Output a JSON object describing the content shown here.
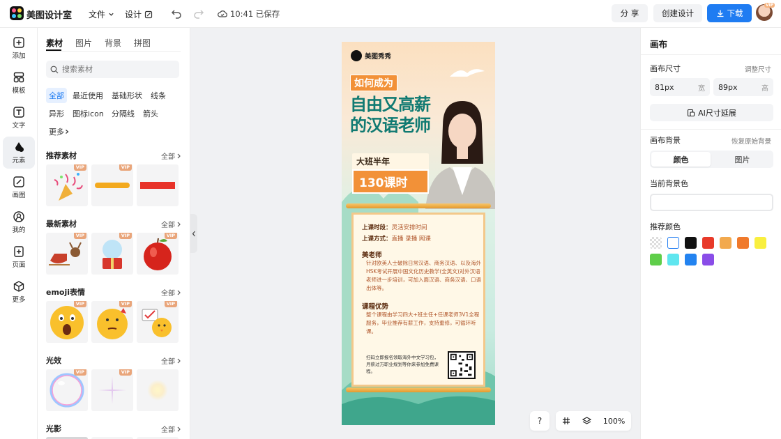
{
  "app": {
    "name": "美图设计室"
  },
  "toolbar": {
    "file_label": "文件",
    "design_label": "设计",
    "saved_status": "10:41 已保存",
    "share_label": "分 享",
    "create_label": "创建设计",
    "download_label": "下载",
    "avatar_badge": "VIP"
  },
  "leftnav": {
    "items": [
      {
        "label": "添加",
        "icon": "plus-square-icon"
      },
      {
        "label": "模板",
        "icon": "template-grid-icon"
      },
      {
        "label": "文字",
        "icon": "text-icon"
      },
      {
        "label": "元素",
        "icon": "shapes-icon",
        "active": true
      },
      {
        "label": "画图",
        "icon": "draw-icon"
      },
      {
        "label": "我的",
        "icon": "user-icon"
      },
      {
        "label": "页面",
        "icon": "page-add-icon"
      },
      {
        "label": "更多",
        "icon": "cube-icon"
      }
    ]
  },
  "panel": {
    "tabs": [
      "素材",
      "图片",
      "背景",
      "拼图"
    ],
    "active_tab": "素材",
    "search_placeholder": "搜索素材",
    "chips": [
      "全部",
      "最近使用",
      "基础形状",
      "线条",
      "异形",
      "图标icon",
      "分隔线",
      "箭头",
      "更多"
    ],
    "sections": [
      {
        "title": "推荐素材",
        "more": "全部"
      },
      {
        "title": "最新素材",
        "more": "全部"
      },
      {
        "title": "emoji表情",
        "more": "全部"
      },
      {
        "title": "光效",
        "more": "全部"
      },
      {
        "title": "光影",
        "more": "全部"
      }
    ],
    "vip_label": "VIP"
  },
  "poster": {
    "brand": "美图秀秀",
    "tag": "如何成为",
    "headline_line1": "自由又高薪",
    "headline_line2": "的汉语老师",
    "badge_line1": "大班半年",
    "badge_line2": "130课时",
    "schedule_label": "上课时段：",
    "schedule_value": "灵活安排时间",
    "method_label": "上课方式：",
    "method_value": "直播 录播 网课",
    "teacher_head": "美老师",
    "teacher_para": "针对欧美人士破除日常汉语、商务汉语、以及海外HSK考试开展中国文化历史教学(全英文)对外汉语老师进一步培训，可加入面汉语、商务汉语、口语出体等。",
    "adv_head": "课程优势",
    "adv_para": "整个课程由学习四大+班主任+任课老师3V1全程服务，毕业推荐有薪工作，支持重修，可循环听课。",
    "footer_text": "扫码立即报名领取海外中文学习包，月薪过万职业规划等你来参加免费课程。"
  },
  "canvas": {
    "zoom_label": "100%",
    "help_label": "?"
  },
  "rpanel": {
    "title": "画布",
    "size_label": "画布尺寸",
    "adjust_label": "调整尺寸",
    "width_value": "81px",
    "width_unit": "宽",
    "height_value": "89px",
    "height_unit": "高",
    "ai_extend_label": "AI尺寸延展",
    "bg_label": "画布背景",
    "restore_label": "恢复原始背景",
    "seg_color": "颜色",
    "seg_image": "图片",
    "current_bg_label": "当前背景色",
    "recommend_label": "推荐颜色",
    "swatches": [
      "transparent",
      "#ffffff",
      "#111111",
      "#e83a2a",
      "#f2a94e",
      "#f07a2c",
      "#f9ef3f",
      "#5fce4a",
      "#5fe6ef",
      "#2383f0",
      "#8a4de8"
    ]
  }
}
